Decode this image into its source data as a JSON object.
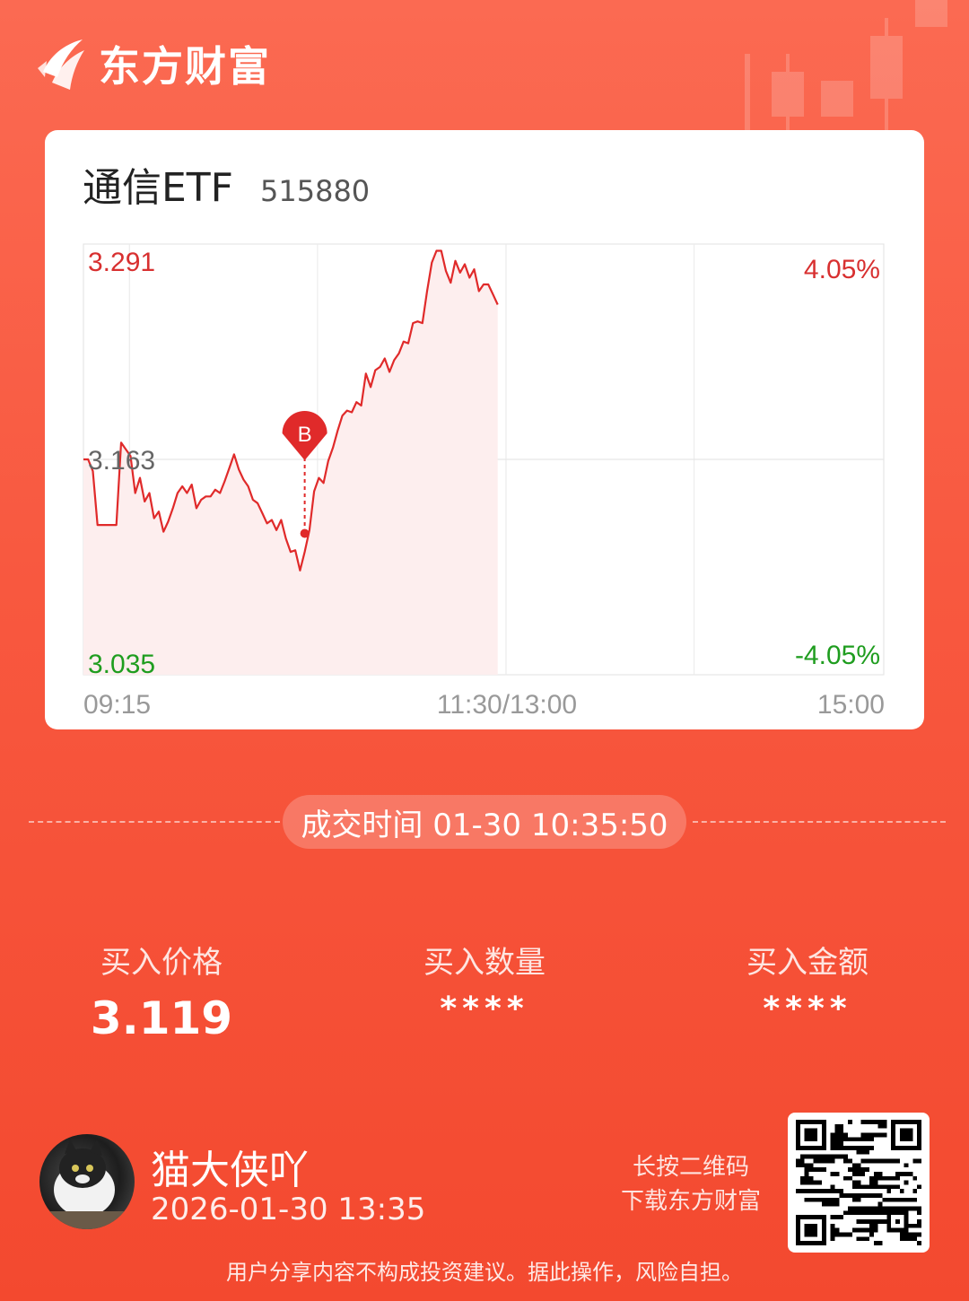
{
  "brand": {
    "logo_text": "东方财富"
  },
  "stock": {
    "name": "通信ETF",
    "code": "515880"
  },
  "chart_data": {
    "type": "line",
    "x_ticks": [
      "09:15",
      "11:30/13:00",
      "15:00"
    ],
    "y_left_ticks": {
      "high": "3.291",
      "mid": "3.163",
      "low": "3.035"
    },
    "y_right_ticks": {
      "high": "4.05%",
      "low": "-4.05%"
    },
    "ylim": [
      3.035,
      3.291
    ],
    "prev_close": 3.163,
    "series": [
      {
        "values": [
          3.163,
          3.163,
          3.156,
          3.124,
          3.124,
          3.124,
          3.124,
          3.124,
          3.173,
          3.169,
          3.165,
          3.143,
          3.152,
          3.138,
          3.143,
          3.128,
          3.132,
          3.12,
          3.126,
          3.134,
          3.143,
          3.147,
          3.143,
          3.148,
          3.134,
          3.139,
          3.141,
          3.141,
          3.145,
          3.143,
          3.15,
          3.158,
          3.166,
          3.157,
          3.151,
          3.147,
          3.139,
          3.137,
          3.131,
          3.125,
          3.127,
          3.121,
          3.127,
          3.116,
          3.108,
          3.109,
          3.097,
          3.108,
          3.121,
          3.144,
          3.152,
          3.149,
          3.162,
          3.17,
          3.18,
          3.189,
          3.192,
          3.191,
          3.197,
          3.195,
          3.214,
          3.206,
          3.216,
          3.218,
          3.223,
          3.215,
          3.222,
          3.226,
          3.233,
          3.232,
          3.244,
          3.245,
          3.244,
          3.263,
          3.28,
          3.287,
          3.287,
          3.275,
          3.268,
          3.281,
          3.274,
          3.279,
          3.271,
          3.276,
          3.263,
          3.267,
          3.267,
          3.261,
          3.255
        ]
      }
    ],
    "buy_marker": {
      "label": "B",
      "price": 3.119
    }
  },
  "trade_time": "成交时间 01-30 10:35:50",
  "stats": [
    {
      "label": "买入价格",
      "value": "3.119"
    },
    {
      "label": "买入数量",
      "value": "****"
    },
    {
      "label": "买入金额",
      "value": "****"
    }
  ],
  "user": {
    "name": "猫大侠吖",
    "share_time": "2026-01-30 13:35"
  },
  "qr": {
    "hint_line1": "长按二维码",
    "hint_line2": "下载东方财富"
  },
  "disclaimer": "用户分享内容不构成投资建议。据此操作，风险自担。",
  "colors": {
    "up": "#e02a2a",
    "down": "#1f9d1f",
    "bg": "#f8583f"
  }
}
